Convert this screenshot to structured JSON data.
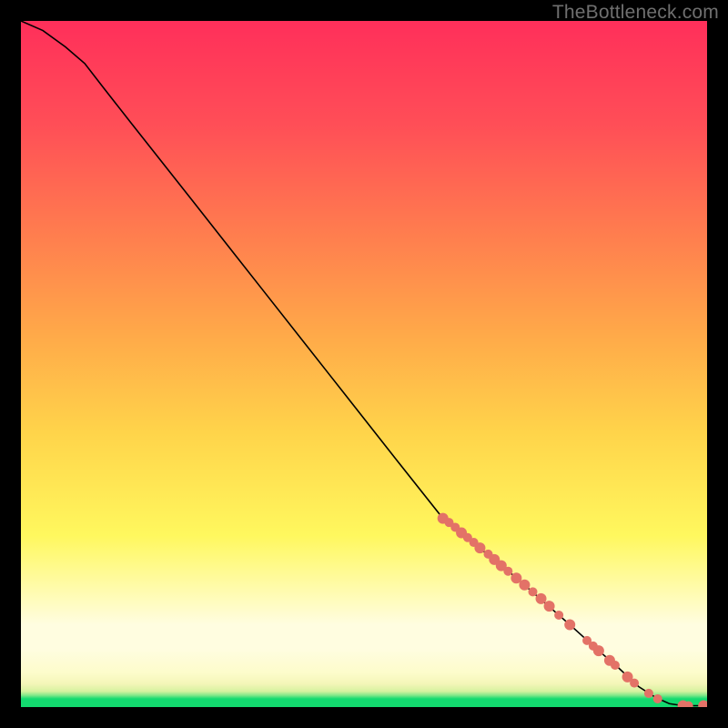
{
  "watermark": "TheBottleneck.com",
  "colors": {
    "marker": "#e37267",
    "curve": "#000000"
  },
  "chart_data": {
    "type": "line",
    "title": "",
    "xlabel": "",
    "ylabel": "",
    "xlim": [
      0,
      100
    ],
    "ylim": [
      0,
      100
    ],
    "grid": false,
    "legend": false,
    "curve": [
      {
        "x": 0.0,
        "y": 100.0
      },
      {
        "x": 3.2,
        "y": 98.6
      },
      {
        "x": 6.5,
        "y": 96.2
      },
      {
        "x": 9.3,
        "y": 93.8
      },
      {
        "x": 12.0,
        "y": 90.3
      },
      {
        "x": 16.0,
        "y": 85.2
      },
      {
        "x": 25.0,
        "y": 73.8
      },
      {
        "x": 35.0,
        "y": 61.1
      },
      {
        "x": 45.0,
        "y": 48.4
      },
      {
        "x": 55.0,
        "y": 35.7
      },
      {
        "x": 61.5,
        "y": 27.5
      },
      {
        "x": 72.0,
        "y": 19.0
      },
      {
        "x": 80.0,
        "y": 12.0
      },
      {
        "x": 84.0,
        "y": 8.4
      },
      {
        "x": 87.0,
        "y": 5.8
      },
      {
        "x": 90.0,
        "y": 3.0
      },
      {
        "x": 92.5,
        "y": 1.4
      },
      {
        "x": 94.5,
        "y": 0.5
      },
      {
        "x": 96.5,
        "y": 0.2
      },
      {
        "x": 98.0,
        "y": 0.2
      },
      {
        "x": 99.5,
        "y": 0.2
      }
    ],
    "markers": [
      {
        "x": 61.5,
        "y": 27.5,
        "r": 6
      },
      {
        "x": 62.4,
        "y": 26.9,
        "r": 5
      },
      {
        "x": 63.3,
        "y": 26.2,
        "r": 5
      },
      {
        "x": 64.2,
        "y": 25.4,
        "r": 6
      },
      {
        "x": 65.1,
        "y": 24.7,
        "r": 5
      },
      {
        "x": 66.0,
        "y": 24.0,
        "r": 5
      },
      {
        "x": 66.9,
        "y": 23.2,
        "r": 6
      },
      {
        "x": 68.1,
        "y": 22.3,
        "r": 5
      },
      {
        "x": 69.0,
        "y": 21.5,
        "r": 6
      },
      {
        "x": 70.0,
        "y": 20.6,
        "r": 6
      },
      {
        "x": 71.0,
        "y": 19.8,
        "r": 5
      },
      {
        "x": 72.2,
        "y": 18.8,
        "r": 6
      },
      {
        "x": 73.4,
        "y": 17.8,
        "r": 6
      },
      {
        "x": 74.6,
        "y": 16.8,
        "r": 5
      },
      {
        "x": 75.8,
        "y": 15.8,
        "r": 6
      },
      {
        "x": 77.0,
        "y": 14.7,
        "r": 6
      },
      {
        "x": 78.4,
        "y": 13.4,
        "r": 5
      },
      {
        "x": 80.0,
        "y": 12.0,
        "r": 6
      },
      {
        "x": 82.5,
        "y": 9.7,
        "r": 5
      },
      {
        "x": 83.4,
        "y": 8.9,
        "r": 5
      },
      {
        "x": 84.2,
        "y": 8.2,
        "r": 6
      },
      {
        "x": 85.8,
        "y": 6.8,
        "r": 6
      },
      {
        "x": 86.6,
        "y": 6.1,
        "r": 5
      },
      {
        "x": 88.4,
        "y": 4.4,
        "r": 6
      },
      {
        "x": 89.4,
        "y": 3.5,
        "r": 5
      },
      {
        "x": 91.5,
        "y": 2.0,
        "r": 5
      },
      {
        "x": 92.8,
        "y": 1.2,
        "r": 5
      },
      {
        "x": 96.5,
        "y": 0.2,
        "r": 6
      },
      {
        "x": 97.3,
        "y": 0.2,
        "r": 5
      },
      {
        "x": 99.5,
        "y": 0.2,
        "r": 6
      }
    ]
  }
}
